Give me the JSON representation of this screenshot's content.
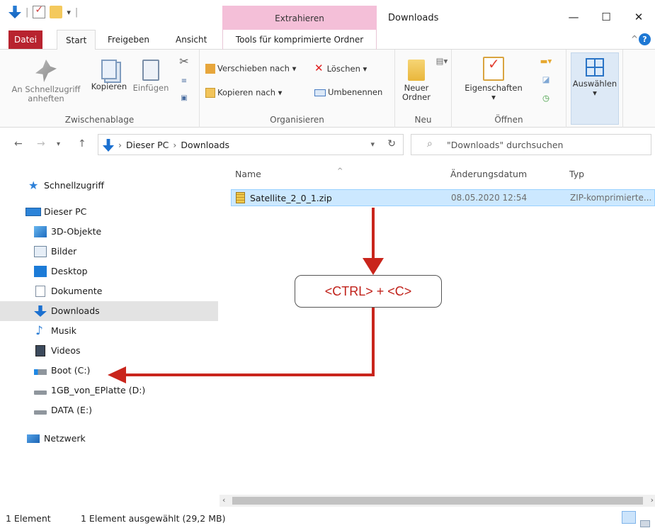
{
  "titlebar": {
    "context_tab": "Extrahieren",
    "window_title": "Downloads",
    "controls": {
      "minimize": "—",
      "maximize": "☐",
      "close": "✕"
    }
  },
  "tabs": {
    "file": "Datei",
    "start": "Start",
    "share": "Freigeben",
    "view": "Ansicht",
    "tools": "Tools für komprimierte Ordner"
  },
  "ribbon": {
    "clipboard": {
      "label": "Zwischenablage",
      "pin": "An Schnellzugriff anheften",
      "copy": "Kopieren",
      "paste": "Einfügen"
    },
    "organize": {
      "label": "Organisieren",
      "move_to": "Verschieben nach ▾",
      "copy_to": "Kopieren nach ▾",
      "delete": "Löschen ▾",
      "rename": "Umbenennen"
    },
    "new": {
      "label": "Neu",
      "new_folder": "Neuer Ordner"
    },
    "open": {
      "label": "Öffnen",
      "properties": "Eigenschaften"
    },
    "select": {
      "label": "Auswählen"
    }
  },
  "address": {
    "crumbs": [
      "Dieser PC",
      "Downloads"
    ],
    "search_placeholder": "\"Downloads\" durchsuchen"
  },
  "sidebar": {
    "items": [
      {
        "label": "Schnellzugriff",
        "icon": "star-icon"
      },
      {
        "label": "Dieser PC",
        "icon": "computer-icon"
      },
      {
        "label": "3D-Objekte",
        "icon": "cube-icon"
      },
      {
        "label": "Bilder",
        "icon": "pictures-icon"
      },
      {
        "label": "Desktop",
        "icon": "desktop-icon"
      },
      {
        "label": "Dokumente",
        "icon": "document-icon"
      },
      {
        "label": "Downloads",
        "icon": "download-icon",
        "selected": true
      },
      {
        "label": "Musik",
        "icon": "music-icon"
      },
      {
        "label": "Videos",
        "icon": "video-icon"
      },
      {
        "label": "Boot (C:)",
        "icon": "os-drive-icon"
      },
      {
        "label": "1GB_von_EPlatte (D:)",
        "icon": "drive-icon"
      },
      {
        "label": "DATA (E:)",
        "icon": "drive-icon"
      },
      {
        "label": "Netzwerk",
        "icon": "network-icon"
      }
    ]
  },
  "columns": {
    "name": "Name",
    "modified": "Änderungsdatum",
    "type": "Typ"
  },
  "files": [
    {
      "name": "Satellite_2_0_1.zip",
      "modified": "08.05.2020 12:54",
      "type": "ZIP-komprimierte...",
      "selected": true
    }
  ],
  "annotation": {
    "label": "<CTRL> + <C>",
    "color": "#c0211a"
  },
  "status": {
    "count": "1 Element",
    "selection": "1 Element ausgewählt (29,2 MB)"
  },
  "colors": {
    "file_tab": "#b8232f",
    "context_tab": "#f4bfd8",
    "selection": "#cce8ff",
    "accent": "#1b70d0"
  }
}
